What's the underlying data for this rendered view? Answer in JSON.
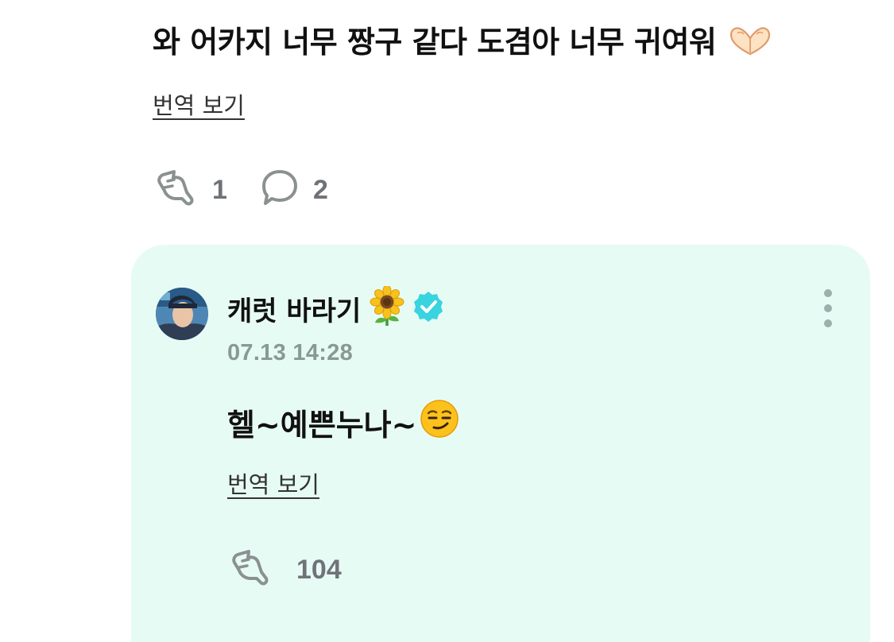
{
  "post": {
    "text": "와 어카지 너무 짱구 같다 도겸아 너무 귀여워",
    "emoji": "heart-hands",
    "translate_label": "번역 보기",
    "likes": "1",
    "replies": "2"
  },
  "reply": {
    "author": "캐럿 바라기",
    "author_emoji": "sunflower",
    "verified": true,
    "timestamp": "07.13 14:28",
    "text": "헬~예쁜누나~",
    "emoji": "smirking-face",
    "translate_label": "번역 보기",
    "likes": "104"
  },
  "colors": {
    "card_background": "#e7fbf5",
    "verified_badge": "#38d4df",
    "count_text": "#6f7378",
    "timestamp_text": "#8a9995"
  }
}
